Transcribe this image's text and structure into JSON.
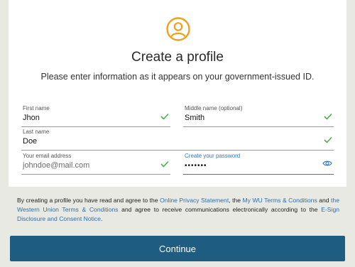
{
  "header": {
    "title": "Create a profile",
    "subtitle": "Please enter information as it appears on your government-issued ID."
  },
  "fields": {
    "first_name": {
      "label": "First name",
      "value": "Jhon"
    },
    "middle_name": {
      "label": "Middle name (optional)",
      "value": "Smith"
    },
    "last_name": {
      "label": "Last name",
      "value": "Doe"
    },
    "email": {
      "label": "Your email address",
      "value": "johndoe@mail.com"
    },
    "password": {
      "label": "Create your password",
      "value": "•••••••"
    }
  },
  "terms": {
    "t1": "By creating a profile you have read and agree to the ",
    "link1": "Online Privacy Statement",
    "t2": ", the ",
    "link2": "My WU Terms & Conditions",
    "t3": " and ",
    "link3": "the Western Union Terms & Conditions",
    "t4": " and agree to receive communications electronically according to the ",
    "link4": "E-Sign Disclosure and Consent Notice",
    "t5": "."
  },
  "actions": {
    "continue_label": "Continue"
  },
  "colors": {
    "accent_orange": "#f0a020",
    "check_green": "#4caf50",
    "link_blue": "#2e6fa8",
    "button_blue": "#1f5c82"
  },
  "icons": {
    "avatar": "user-avatar-icon",
    "valid": "checkmark-icon",
    "reveal": "eye-icon"
  }
}
